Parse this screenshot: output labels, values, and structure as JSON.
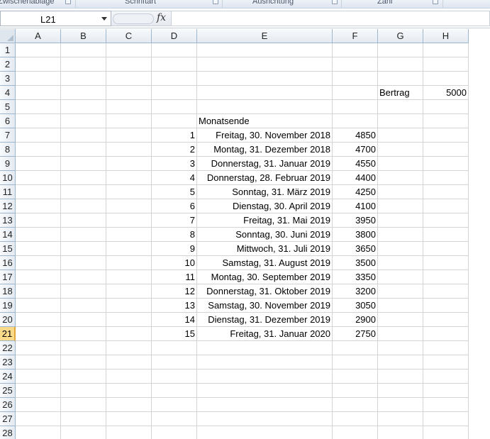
{
  "ribbon": {
    "groups": [
      "Zwischenablage",
      "Schriftart",
      "Ausrichtung",
      "Zahl"
    ]
  },
  "formula_bar": {
    "name_box": "L21",
    "fx": "fx",
    "formula": ""
  },
  "columns": [
    "A",
    "B",
    "C",
    "D",
    "E",
    "F",
    "G",
    "H"
  ],
  "rows": [
    "1",
    "2",
    "3",
    "4",
    "5",
    "6",
    "7",
    "8",
    "9",
    "10",
    "11",
    "12",
    "13",
    "14",
    "15",
    "16",
    "17",
    "18",
    "19",
    "20",
    "21",
    "22",
    "23",
    "24",
    "25",
    "26",
    "27",
    "28"
  ],
  "active_row": "21",
  "cells": {
    "G4": "Bertrag",
    "H4": "5000",
    "E6": "Monatsende",
    "D7": "1",
    "E7": "Freitag, 30. November 2018",
    "F7": "4850",
    "D8": "2",
    "E8": "Montag, 31. Dezember 2018",
    "F8": "4700",
    "D9": "3",
    "E9": "Donnerstag, 31. Januar 2019",
    "F9": "4550",
    "D10": "4",
    "E10": "Donnerstag, 28. Februar 2019",
    "F10": "4400",
    "D11": "5",
    "E11": "Sonntag, 31. März 2019",
    "F11": "4250",
    "D12": "6",
    "E12": "Dienstag, 30. April 2019",
    "F12": "4100",
    "D13": "7",
    "E13": "Freitag, 31. Mai 2019",
    "F13": "3950",
    "D14": "8",
    "E14": "Sonntag, 30. Juni 2019",
    "F14": "3800",
    "D15": "9",
    "E15": "Mittwoch, 31. Juli 2019",
    "F15": "3650",
    "D16": "10",
    "E16": "Samstag, 31. August 2019",
    "F16": "3500",
    "D17": "11",
    "E17": "Montag, 30. September 2019",
    "F17": "3350",
    "D18": "12",
    "E18": "Donnerstag, 31. Oktober 2019",
    "F18": "3200",
    "D19": "13",
    "E19": "Samstag, 30. November 2019",
    "F19": "3050",
    "D20": "14",
    "E20": "Dienstag, 31. Dezember 2019",
    "F20": "2900",
    "D21": "15",
    "E21": "Freitag, 31. Januar 2020",
    "F21": "2750"
  }
}
